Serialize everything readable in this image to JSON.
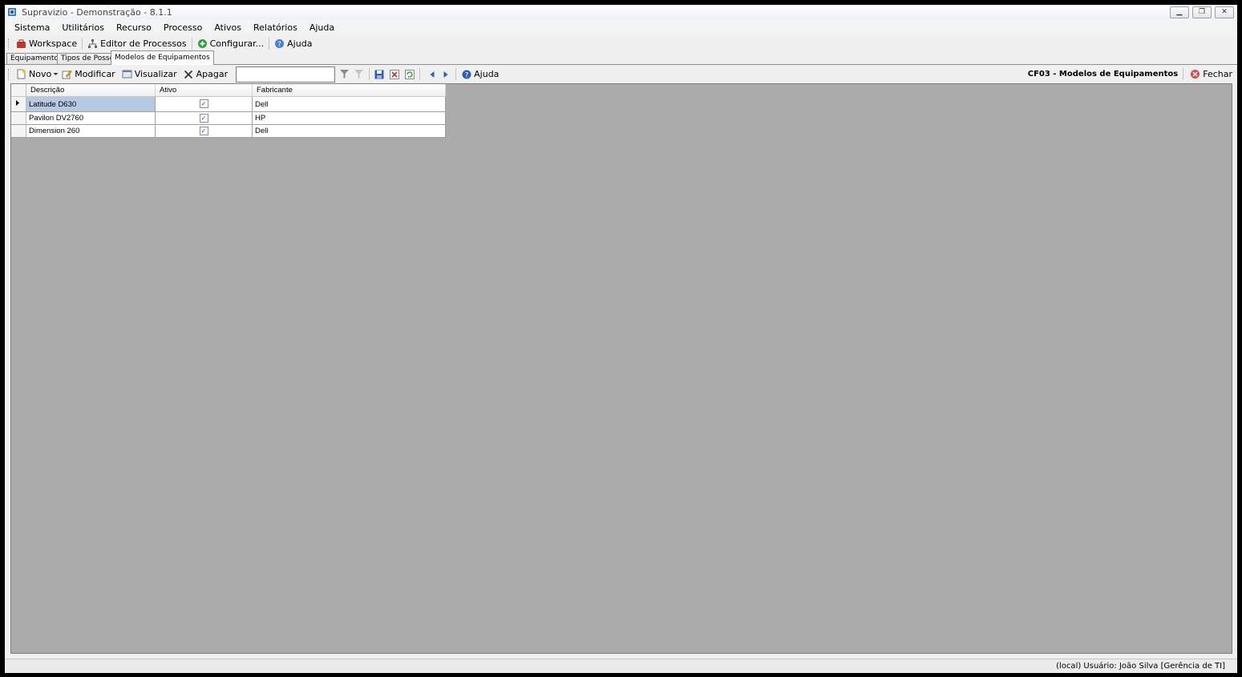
{
  "window": {
    "title": "Supravizio - Demonstração - 8.1.1"
  },
  "menu": [
    "Sistema",
    "Utilitários",
    "Recurso",
    "Processo",
    "Ativos",
    "Relatórios",
    "Ajuda"
  ],
  "toolbar": {
    "workspace": "Workspace",
    "process_editor": "Editor de Processos",
    "configure": "Configurar...",
    "help": "Ajuda"
  },
  "tabs": [
    "Equipamentos",
    "Tipos de Posse",
    "Modelos de Equipamentos"
  ],
  "actions": {
    "new": "Novo",
    "modify": "Modificar",
    "view": "Visualizar",
    "delete": "Apagar",
    "help": "Ajuda",
    "search_value": "",
    "screen_title": "CF03 - Modelos de Equipamentos",
    "close": "Fechar"
  },
  "grid": {
    "columns": [
      "Descrição",
      "Ativo",
      "Fabricante"
    ],
    "rows": [
      {
        "descricao": "Latitude D630",
        "ativo": true,
        "fabricante": "Dell"
      },
      {
        "descricao": "Pavilon DV2760",
        "ativo": true,
        "fabricante": "HP"
      },
      {
        "descricao": "Dimension 260",
        "ativo": true,
        "fabricante": "Dell"
      }
    ]
  },
  "status": {
    "text": "(local)  Usuário: João Silva [Gerência de TI]"
  },
  "colors": {
    "workspace_bg": "#ababab",
    "selection": "#b6c9e3"
  }
}
